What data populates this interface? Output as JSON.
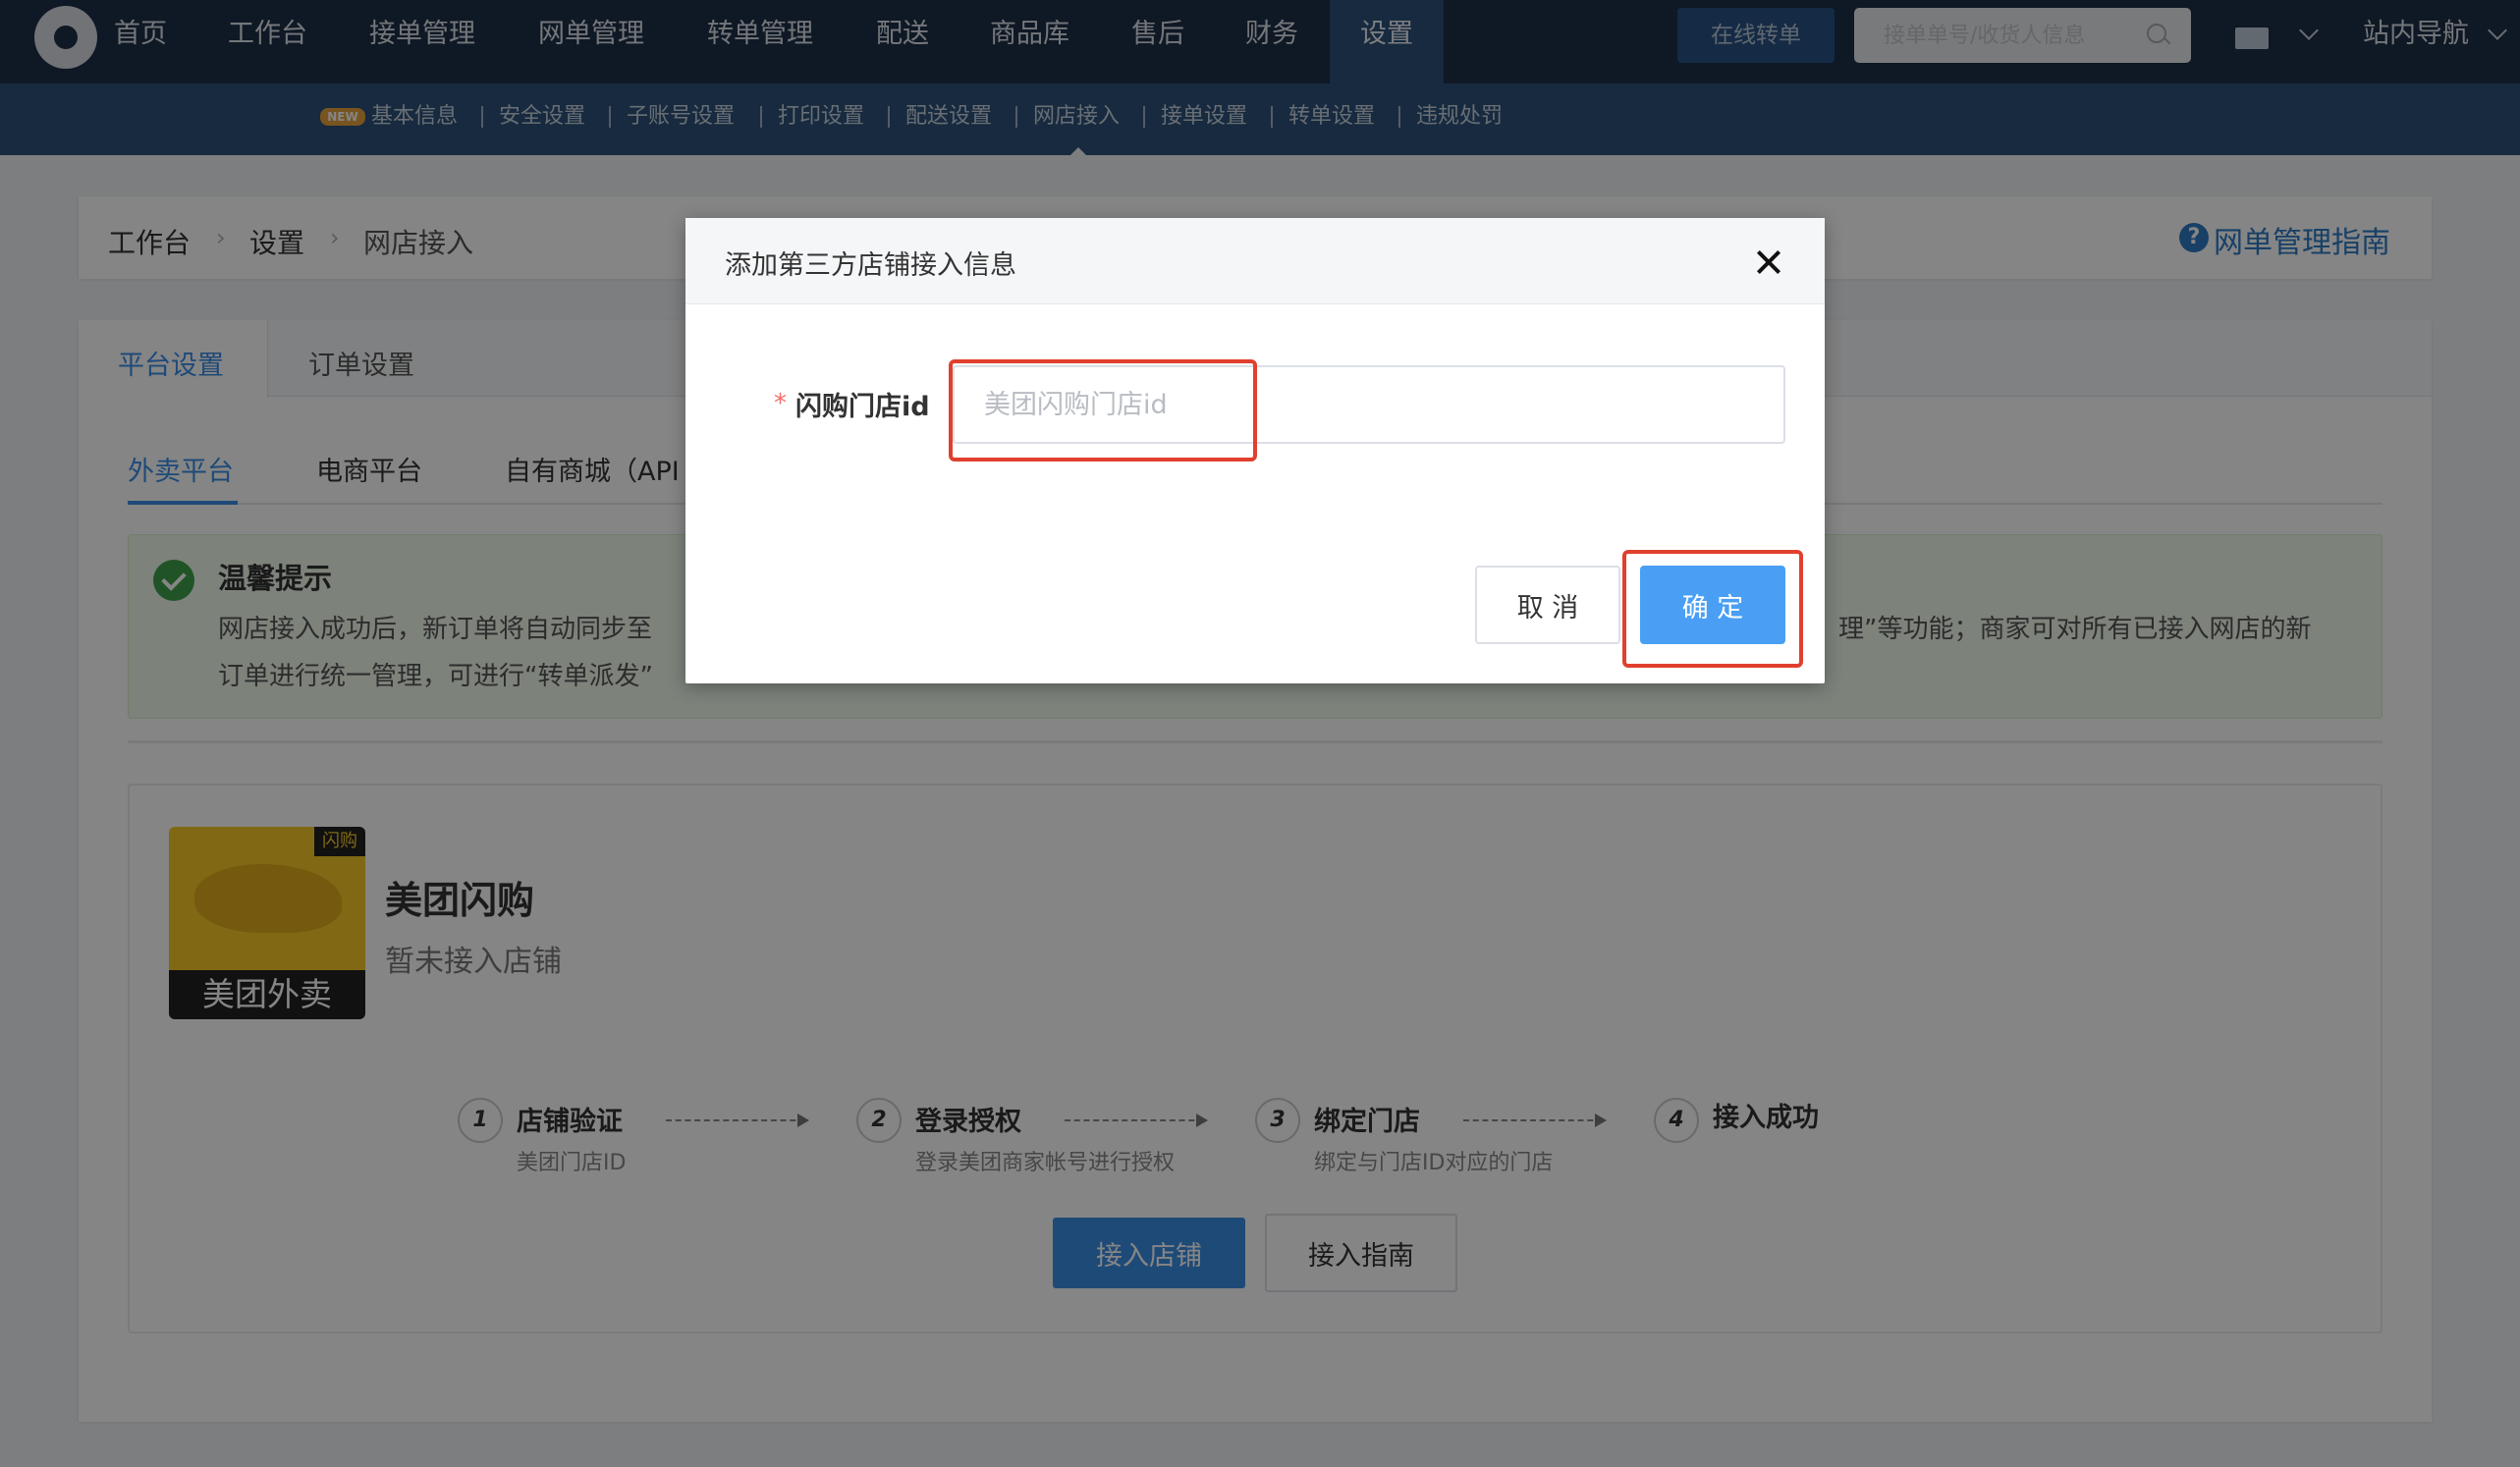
{
  "topnav": {
    "items": [
      "首页",
      "工作台",
      "接单管理",
      "网单管理",
      "转单管理",
      "配送",
      "商品库",
      "售后",
      "财务",
      "设置"
    ],
    "active": "设置",
    "online_transfer_button": "在线转单",
    "search_placeholder": "接单单号/收货人信息",
    "site_nav": "站内导航"
  },
  "subnav": {
    "new_badge": "NEW",
    "items": [
      "基本信息",
      "安全设置",
      "子账号设置",
      "打印设置",
      "配送设置",
      "网店接入",
      "接单设置",
      "转单设置",
      "违规处罚"
    ],
    "active": "网店接入"
  },
  "breadcrumb": {
    "items": [
      "工作台",
      "设置",
      "网店接入"
    ],
    "help_link": "网单管理指南",
    "help_icon_glyph": "?"
  },
  "tabs": {
    "items": [
      "平台设置",
      "订单设置"
    ],
    "active": "平台设置"
  },
  "subtabs": {
    "items": [
      "外卖平台",
      "电商平台",
      "自有商城（API"
    ],
    "active": "外卖平台"
  },
  "tip": {
    "title": "温馨提示",
    "line1_left": "网店接入成功后，新订单将自动同步至",
    "line1_right": "理”等功能；商家可对所有已接入网店的新",
    "line2_left": "订单进行统一管理，可进行“转单派发”"
  },
  "platform": {
    "logo_tag": "闪购",
    "logo_brand": "美团外卖",
    "name": "美团闪购",
    "status": "暂未接入店铺",
    "steps": [
      {
        "num": "1",
        "title": "店铺验证",
        "desc": "美团门店ID"
      },
      {
        "num": "2",
        "title": "登录授权",
        "desc": "登录美团商家帐号进行授权"
      },
      {
        "num": "3",
        "title": "绑定门店",
        "desc": "绑定与门店ID对应的门店"
      },
      {
        "num": "4",
        "title": "接入成功",
        "desc": ""
      }
    ],
    "connect_button": "接入店铺",
    "guide_button": "接入指南"
  },
  "modal": {
    "title": "添加第三方店铺接入信息",
    "field_required_mark": "*",
    "field_label": "闪购门店id",
    "field_placeholder": "美团闪购门店id",
    "field_value": "",
    "cancel_button": "取 消",
    "confirm_button": "确 定"
  },
  "colors": {
    "topbar": "#1e2f47",
    "subbar": "#2d527a",
    "primary": "#3a8ee6",
    "annotation": "#e0402d"
  }
}
